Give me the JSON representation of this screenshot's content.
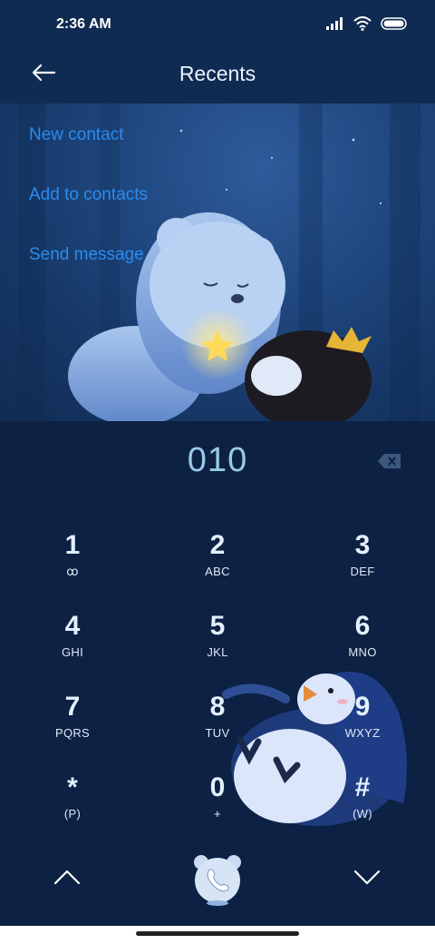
{
  "status": {
    "time": "2:36 AM"
  },
  "header": {
    "title": "Recents"
  },
  "menu": [
    {
      "label": "New contact"
    },
    {
      "label": "Add to contacts"
    },
    {
      "label": "Send message"
    }
  ],
  "dialer": {
    "number": "010",
    "keys": [
      {
        "digit": "1",
        "letters": "ꝏ"
      },
      {
        "digit": "2",
        "letters": "ABC"
      },
      {
        "digit": "3",
        "letters": "DEF"
      },
      {
        "digit": "4",
        "letters": "GHI"
      },
      {
        "digit": "5",
        "letters": "JKL"
      },
      {
        "digit": "6",
        "letters": "MNO"
      },
      {
        "digit": "7",
        "letters": "PQRS"
      },
      {
        "digit": "8",
        "letters": "TUV"
      },
      {
        "digit": "9",
        "letters": "WXYZ"
      },
      {
        "digit": "*",
        "letters": "(P)"
      },
      {
        "digit": "0",
        "letters": "+"
      },
      {
        "digit": "#",
        "letters": "(W)"
      }
    ]
  },
  "colors": {
    "accent": "#2a8cf0",
    "background": "#0c2143",
    "number": "#98cbe6"
  },
  "icons": [
    "signal-icon",
    "wifi-icon",
    "battery-icon",
    "back-arrow-icon",
    "backspace-icon",
    "chevron-up-icon",
    "phone-icon",
    "chevron-down-icon"
  ]
}
